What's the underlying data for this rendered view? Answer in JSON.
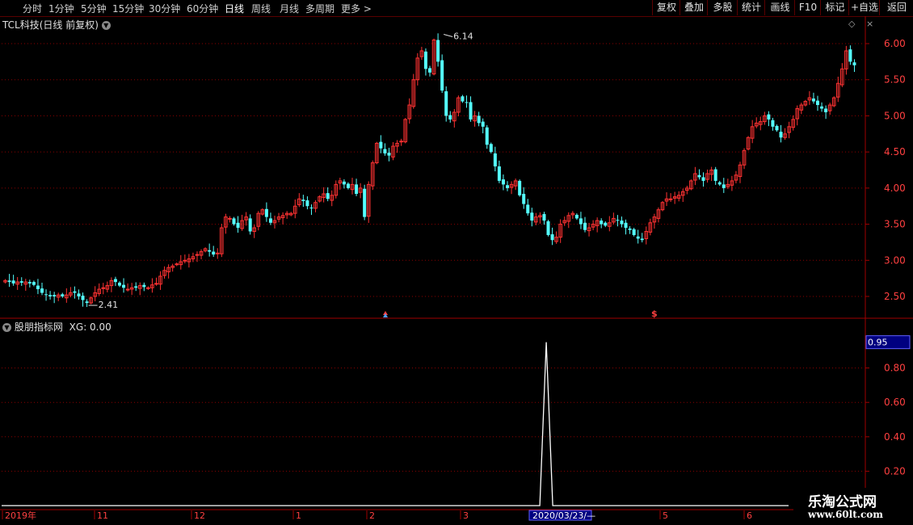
{
  "toolbar": {
    "periods": [
      "分时",
      "1分钟",
      "5分钟",
      "15分钟",
      "30分钟",
      "60分钟",
      "日线",
      "周线",
      "月线",
      "多周期",
      "更多 >"
    ],
    "active_period": "日线",
    "right_buttons": [
      "复权",
      "叠加",
      "多股",
      "统计",
      "画线",
      "F10",
      "标记",
      "+自选",
      "返回"
    ]
  },
  "main_panel": {
    "title": "TCL科技(日线 前复权)"
  },
  "indicator_panel": {
    "name": "股朋指标网",
    "value_label": "XG: 0.00"
  },
  "watermark": {
    "main": "乐淘公式网",
    "url": "www.60lt.com"
  },
  "colors": {
    "up": "#ff3232",
    "down": "#54ffff",
    "grid": "#8b0000",
    "axis_text": "#ff4040",
    "line": "#ffffff",
    "highlight_bg": "#000080"
  },
  "chart_data": [
    {
      "type": "candlestick",
      "title": "TCL科技(日线 前复权)",
      "ylim": [
        2.25,
        6.25
      ],
      "y_ticks": [
        2.5,
        3.0,
        3.5,
        4.0,
        4.5,
        5.0,
        5.5,
        6.0
      ],
      "y_tick_labels": [
        "2.50",
        "3.00",
        "3.50",
        "4.00",
        "4.50",
        "5.00",
        "5.50",
        "6.00"
      ],
      "x_ticks": [
        "2019年",
        "11",
        "12",
        "1",
        "2",
        "3",
        "2020/03/23/—",
        "5",
        "6"
      ],
      "close_series": [
        2.72,
        2.7,
        2.68,
        2.7,
        2.69,
        2.7,
        2.68,
        2.66,
        2.6,
        2.55,
        2.52,
        2.5,
        2.5,
        2.52,
        2.5,
        2.52,
        2.55,
        2.55,
        2.5,
        2.45,
        2.41,
        2.48,
        2.55,
        2.6,
        2.62,
        2.65,
        2.72,
        2.7,
        2.65,
        2.62,
        2.6,
        2.62,
        2.62,
        2.65,
        2.63,
        2.62,
        2.66,
        2.68,
        2.78,
        2.86,
        2.9,
        2.92,
        2.95,
        2.98,
        3.0,
        3.02,
        3.05,
        3.08,
        3.12,
        3.16,
        3.12,
        3.08,
        3.1,
        3.45,
        3.6,
        3.58,
        3.5,
        3.45,
        3.55,
        3.6,
        3.4,
        3.45,
        3.65,
        3.7,
        3.6,
        3.52,
        3.55,
        3.6,
        3.62,
        3.65,
        3.65,
        3.75,
        3.85,
        3.82,
        3.75,
        3.72,
        3.8,
        3.88,
        3.92,
        3.85,
        3.9,
        4.05,
        4.1,
        4.05,
        4.0,
        4.05,
        3.92,
        4.0,
        3.6,
        4.05,
        4.35,
        4.62,
        4.55,
        4.48,
        4.45,
        4.58,
        4.62,
        4.65,
        4.95,
        5.15,
        5.5,
        5.8,
        5.9,
        5.65,
        5.6,
        6.05,
        5.75,
        5.35,
        5.0,
        4.95,
        5.05,
        5.25,
        5.2,
        5.18,
        4.95,
        5.0,
        4.9,
        4.85,
        4.6,
        4.5,
        4.3,
        4.1,
        4.05,
        4.0,
        4.05,
        4.1,
        3.9,
        3.78,
        3.65,
        3.55,
        3.6,
        3.62,
        3.55,
        3.35,
        3.28,
        3.32,
        3.5,
        3.55,
        3.62,
        3.65,
        3.58,
        3.5,
        3.42,
        3.45,
        3.5,
        3.55,
        3.5,
        3.48,
        3.52,
        3.58,
        3.55,
        3.5,
        3.45,
        3.42,
        3.35,
        3.3,
        3.28,
        3.4,
        3.52,
        3.6,
        3.7,
        3.8,
        3.85,
        3.85,
        3.88,
        3.9,
        3.95,
        4.0,
        4.1,
        4.2,
        4.15,
        4.1,
        4.2,
        4.25,
        4.1,
        4.05,
        4.0,
        4.05,
        4.1,
        4.18,
        4.32,
        4.52,
        4.7,
        4.85,
        4.9,
        4.92,
        5.0,
        4.95,
        4.85,
        4.8,
        4.7,
        4.75,
        4.85,
        4.95,
        5.1,
        5.15,
        5.2,
        5.25,
        5.2,
        5.15,
        5.1,
        5.05,
        5.15,
        5.25,
        5.45,
        5.65,
        5.9,
        5.75,
        5.7
      ],
      "annotations": [
        {
          "label": "6.14",
          "index": 107,
          "value": 6.14
        },
        {
          "label": "2.41",
          "index": 20,
          "value": 2.41
        }
      ]
    },
    {
      "type": "line",
      "series": [
        {
          "name": "XG",
          "values": "zero except single spike"
        }
      ],
      "spike_index": 125,
      "spike_value": 0.95,
      "ylim": [
        0,
        1.0
      ],
      "y_ticks": [
        0.2,
        0.4,
        0.6,
        0.8
      ],
      "y_tick_labels": [
        "0.20",
        "0.40",
        "0.60",
        "0.80"
      ],
      "highlight_label": "0.95"
    }
  ]
}
